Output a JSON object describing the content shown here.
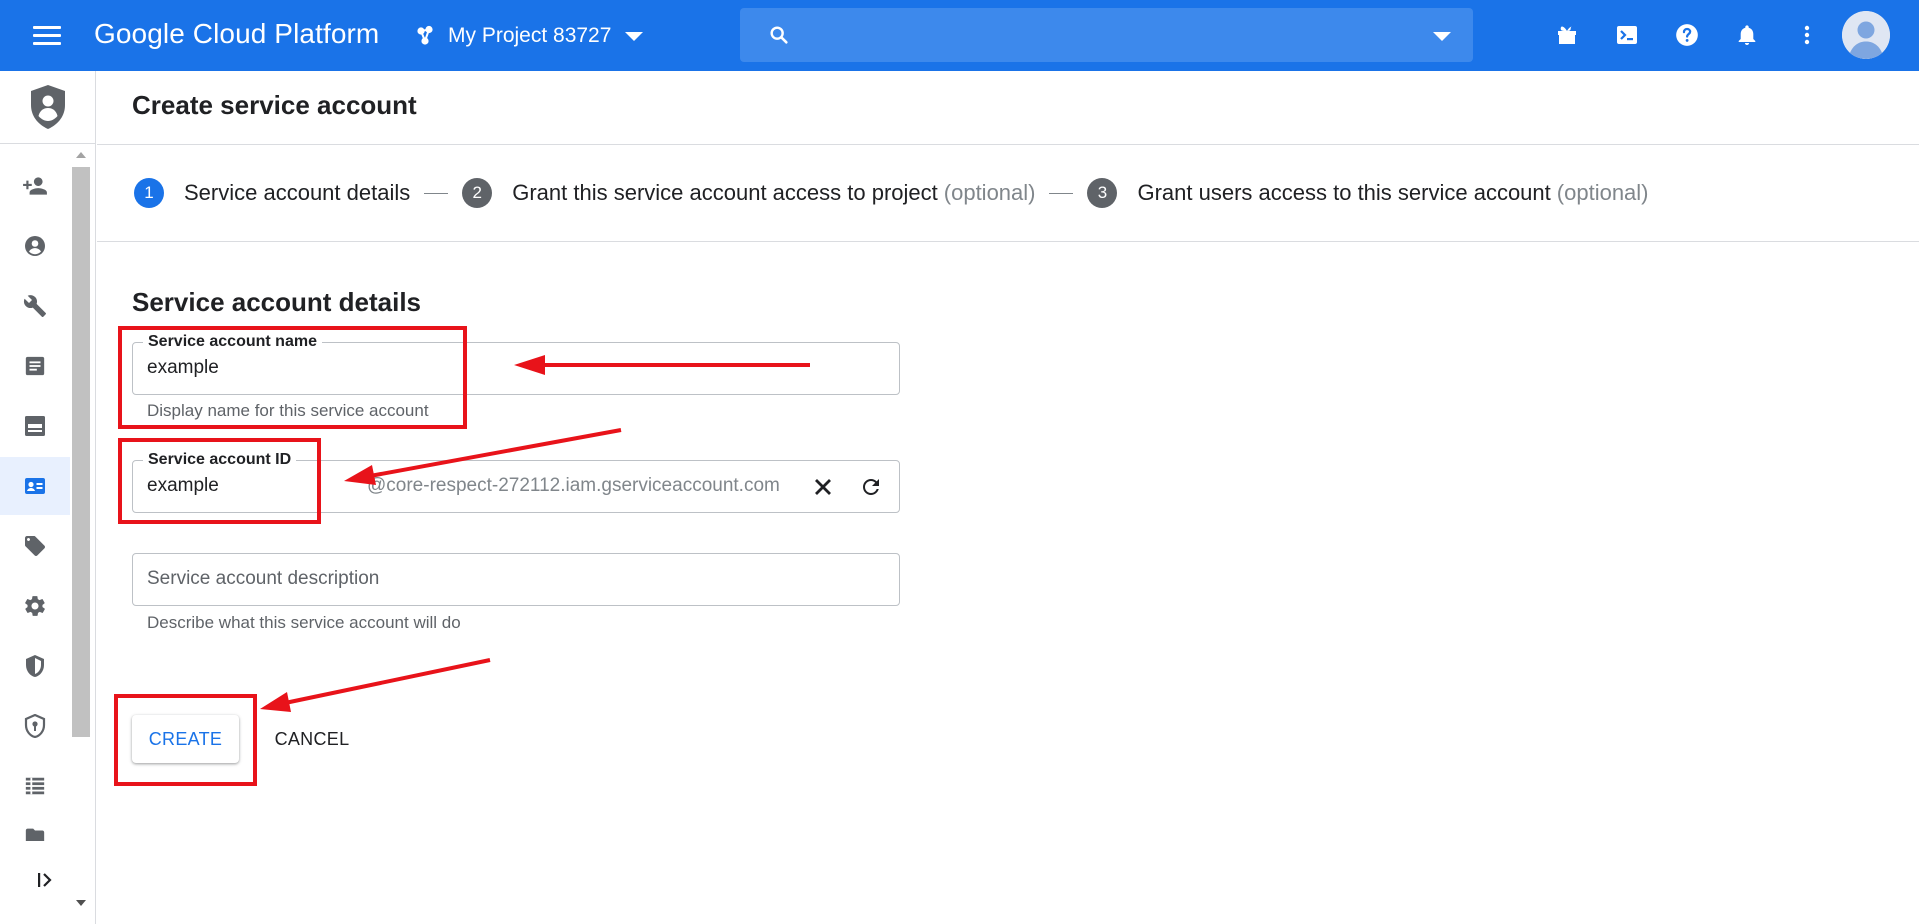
{
  "topbar": {
    "brand": "Google Cloud Platform",
    "project_name": "My Project 83727",
    "search_placeholder": "",
    "icons": [
      "gift-icon",
      "cloud-shell-icon",
      "help-icon",
      "notifications-icon",
      "more-vert-icon"
    ]
  },
  "rail": {
    "header_icon": "iam-shield-person-icon",
    "items": [
      {
        "icon": "person-add-icon",
        "active": false
      },
      {
        "icon": "account-circle-icon",
        "active": false
      },
      {
        "icon": "wrench-icon",
        "active": false
      },
      {
        "icon": "list-icon",
        "active": false
      },
      {
        "icon": "save-icon",
        "active": false
      },
      {
        "icon": "service-account-icon",
        "active": true
      },
      {
        "icon": "tag-icon",
        "active": false
      },
      {
        "icon": "settings-icon",
        "active": false
      },
      {
        "icon": "shield-icon",
        "active": false
      },
      {
        "icon": "security-shield-icon",
        "active": false
      },
      {
        "icon": "table-icon",
        "active": false
      }
    ],
    "collapse_icon": "expand-rail-icon"
  },
  "page": {
    "title": "Create service account"
  },
  "stepper": {
    "steps": [
      {
        "number": "1",
        "label": "Service account details",
        "optional": "",
        "active": true
      },
      {
        "number": "2",
        "label": "Grant this service account access to project",
        "optional": "(optional)",
        "active": false
      },
      {
        "number": "3",
        "label": "Grant users access to this service account",
        "optional": "(optional)",
        "active": false
      }
    ]
  },
  "form": {
    "section_title": "Service account details",
    "name_field": {
      "label": "Service account name",
      "value": "example",
      "hint": "Display name for this service account"
    },
    "id_field": {
      "label": "Service account ID",
      "value": "example",
      "suffix": "@core-respect-272112.iam.gserviceaccount.com"
    },
    "description_field": {
      "placeholder": "Service account description",
      "value": "",
      "hint": "Describe what this service account will do"
    },
    "create_label": "CREATE",
    "cancel_label": "CANCEL"
  },
  "colors": {
    "topbar": "#1a73e8",
    "search_bg": "#3d89ec",
    "accent": "#1a73e8",
    "annotation": "#e8131a"
  }
}
